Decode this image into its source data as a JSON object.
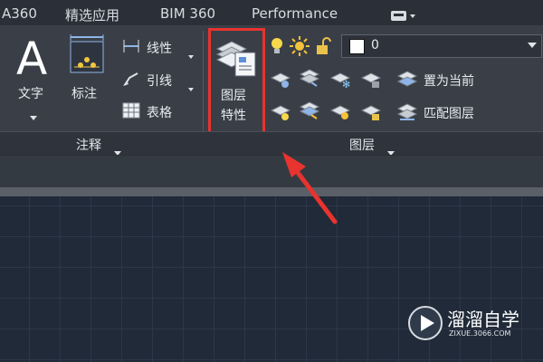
{
  "top_tabs": [
    "A360",
    "精选应用",
    "BIM 360",
    "Performance"
  ],
  "ribbon": {
    "text_label": "文字",
    "dim_label": "标注",
    "linear_label": "线性",
    "leader_label": "引线",
    "table_label": "表格",
    "layer_props_line1": "图层",
    "layer_props_line2": "特性",
    "layer_value": "0",
    "set_current_label": "置为当前",
    "match_layer_label": "匹配图层",
    "annotation_panel": "注释",
    "layers_panel": "图层"
  },
  "watermark": {
    "brand": "溜溜自学",
    "url": "ZIXUE.3066.COM"
  },
  "colors": {
    "highlight": "#e8332e",
    "arrow": "#e8332e"
  }
}
